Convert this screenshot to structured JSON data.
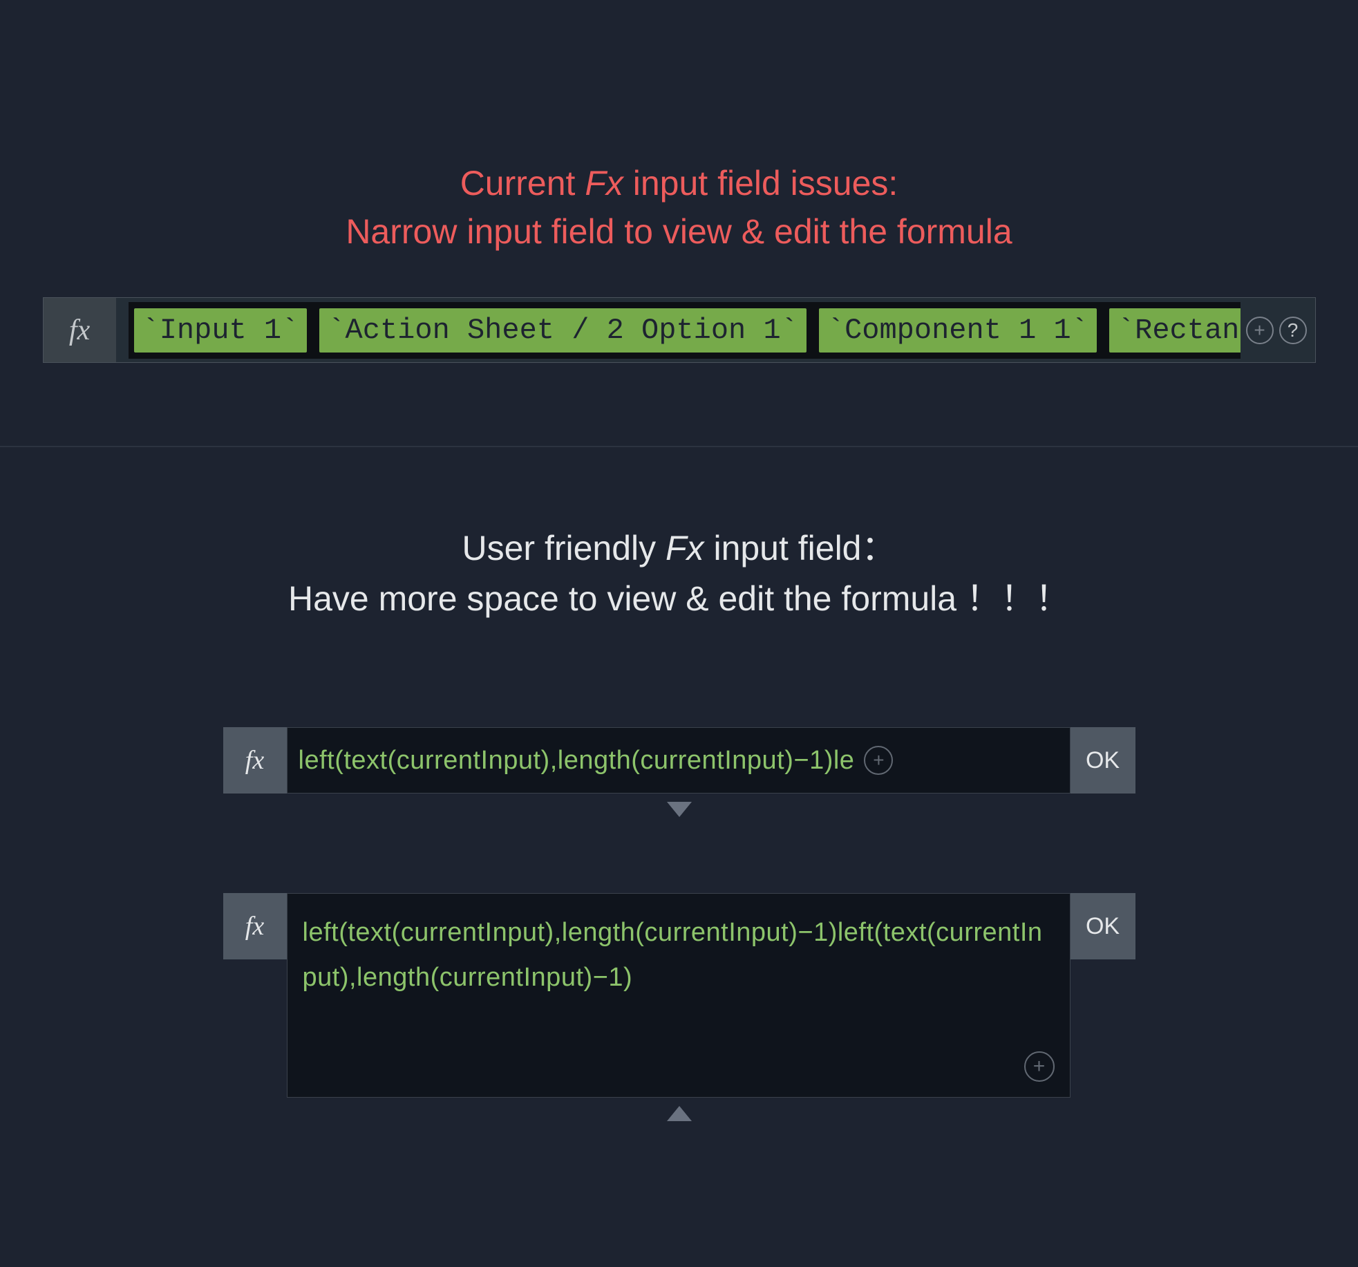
{
  "section1": {
    "heading_pre": "Current ",
    "heading_fx": "Fx",
    "heading_post": " input field issues:",
    "heading_line2": "Narrow input field to view & edit the formula",
    "fx_label": "fx",
    "tokens": [
      "`Input 1`",
      "`Action Sheet / 2 Option 1`",
      "`Component 1 1`",
      "`Rectangl"
    ],
    "plus_glyph": "+",
    "help_glyph": "?"
  },
  "section2": {
    "heading_pre": "User friendly ",
    "heading_fx": "Fx",
    "heading_post": " input field：",
    "heading_line2": "Have more space to view & edit the formula ！！！",
    "fx_label": "fx",
    "ok_label": "OK",
    "collapsed_formula": "left(text(currentInput),length(currentInput)−1)le",
    "expanded_formula": "left(text(currentInput),length(currentInput)−1)left(text(currentInput),length(currentInput)−1)",
    "plus_glyph": "+"
  }
}
